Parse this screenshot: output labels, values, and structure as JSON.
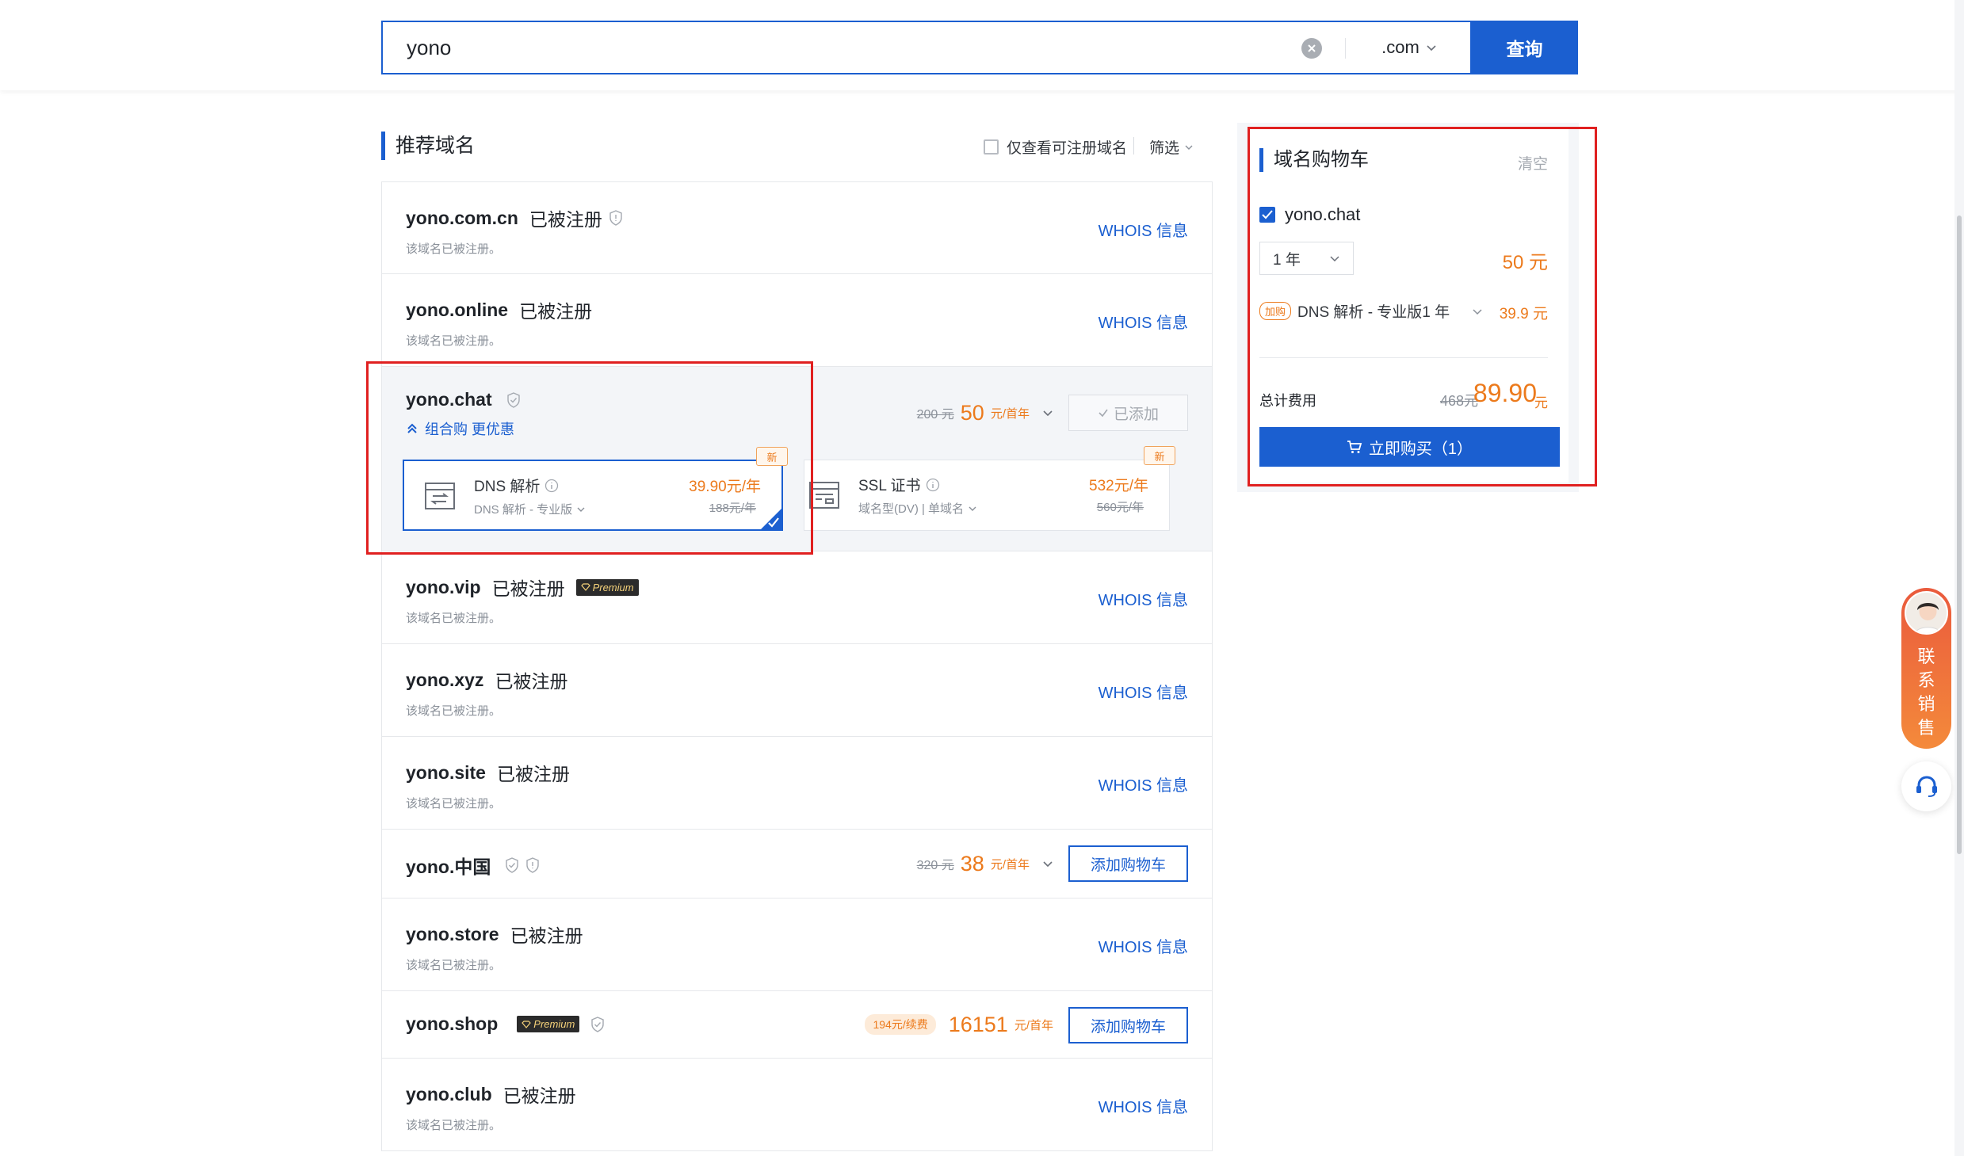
{
  "search": {
    "query": "yono",
    "tld": ".com",
    "button_label": "查询"
  },
  "section": {
    "title": "推荐域名",
    "only_available_label": "仅查看可注册域名",
    "filter_label": "筛选"
  },
  "common": {
    "registered_status": "已被注册",
    "registered_note": "该域名已被注册。",
    "whois_label": "WHOIS 信息",
    "add_to_cart": "添加购物车",
    "added_label": "已添加",
    "premium_label": "Premium",
    "new_tag": "新"
  },
  "domains": [
    {
      "name_base": "yono",
      "name_tld": ".com.cn",
      "state": "taken"
    },
    {
      "name_base": "yono",
      "name_tld": ".online",
      "state": "taken"
    },
    {
      "name_base": "yono",
      "name_tld": ".chat",
      "state": "added",
      "price_old": "200 元",
      "price_new": "50",
      "price_unit": "元/首年"
    },
    {
      "name_base": "yono",
      "name_tld": ".vip",
      "state": "taken",
      "premium": true
    },
    {
      "name_base": "yono",
      "name_tld": ".xyz",
      "state": "taken"
    },
    {
      "name_base": "yono",
      "name_tld": ".site",
      "state": "taken"
    },
    {
      "name_base": "yono",
      "name_tld": ".中国",
      "state": "available",
      "price_old": "320 元",
      "price_new": "38",
      "price_unit": "元/首年"
    },
    {
      "name_base": "yono",
      "name_tld": ".store",
      "state": "taken"
    },
    {
      "name_base": "yono",
      "name_tld": ".shop",
      "state": "available",
      "premium": true,
      "renew": "194元/续费",
      "price_new": "16151",
      "price_unit": "元/首年"
    },
    {
      "name_base": "yono",
      "name_tld": ".club",
      "state": "taken"
    }
  ],
  "bundle": {
    "link_label": "组合购 更优惠",
    "dns": {
      "title": "DNS 解析",
      "sub": "DNS 解析 - 专业版",
      "price": "39.90元/年",
      "old": "188元/年"
    },
    "ssl": {
      "title": "SSL 证书",
      "sub": "域名型(DV) | 单域名",
      "price": "532元/年",
      "old": "560元/年"
    }
  },
  "cart": {
    "title": "域名购物车",
    "clear_label": "清空",
    "item_name": "yono.chat",
    "year": "1 年",
    "item_price": "50 元",
    "addon_tag": "加购",
    "addon_name": "DNS 解析 - 专业版1 年",
    "addon_price": "39.9 元",
    "total_label": "总计费用",
    "total_old": "468元",
    "total_new": "89.90",
    "total_unit": "元",
    "buy_label": "立即购买（1）"
  },
  "sales_widget": {
    "text": [
      "联",
      "系",
      "销",
      "售"
    ]
  },
  "colors": {
    "accent": "#1b5fd0",
    "price": "#ec7a1c",
    "annotation": "#e02020"
  }
}
